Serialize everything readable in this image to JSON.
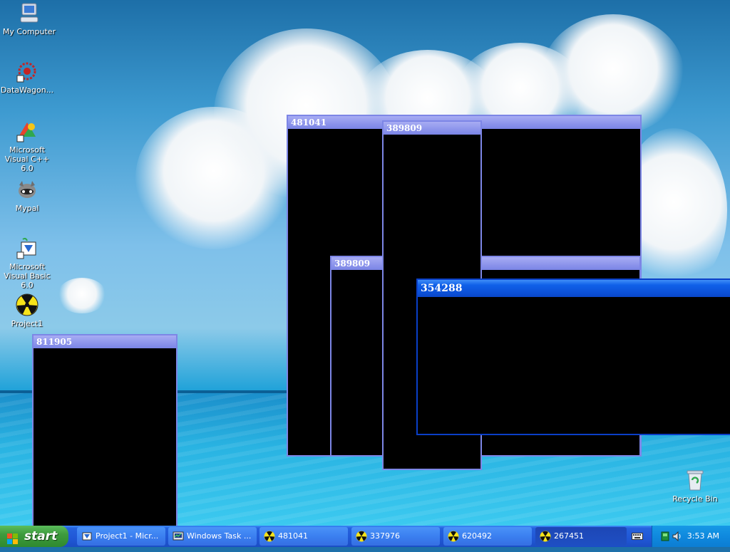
{
  "desktop_icons": [
    {
      "label": "My Computer",
      "icon": "computer-icon"
    },
    {
      "label": "DataWagon...",
      "icon": "datawagon-icon"
    },
    {
      "label": "Microsoft Visual C++ 6.0",
      "icon": "visual-cpp-icon"
    },
    {
      "label": "Mypal",
      "icon": "mypal-icon"
    },
    {
      "label": "Microsoft Visual Basic 6.0",
      "icon": "visual-basic-icon"
    },
    {
      "label": "Project1",
      "icon": "radiation-icon"
    },
    {
      "label": "Recycle Bin",
      "icon": "recycle-bin-icon"
    }
  ],
  "windows": [
    {
      "title": "481041",
      "active": false
    },
    {
      "title": "389809",
      "active": false
    },
    {
      "title": "389809",
      "active": false
    },
    {
      "title": "811905",
      "active": false
    },
    {
      "title": "354288",
      "active": true
    }
  ],
  "taskbar": {
    "start_label": "start",
    "buttons": [
      {
        "label": "Project1 - Micr...",
        "icon": "vb-project-icon"
      },
      {
        "label": "Windows Task ...",
        "icon": "task-manager-icon"
      },
      {
        "label": "481041",
        "icon": "radiation-icon"
      },
      {
        "label": "337976",
        "icon": "radiation-icon"
      },
      {
        "label": "620492",
        "icon": "radiation-icon"
      },
      {
        "label": "267451",
        "icon": "radiation-icon"
      }
    ],
    "clock": "3:53 AM"
  },
  "colors": {
    "taskbar_blue": "#2459d4",
    "start_green": "#3e9b3e",
    "active_title": "#0b4fd6",
    "inactive_title": "#7a84e6"
  }
}
